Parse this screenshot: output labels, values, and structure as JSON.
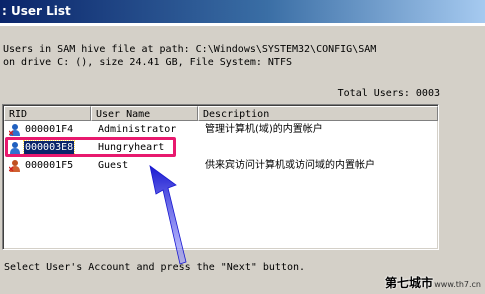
{
  "window": {
    "title": ": User List"
  },
  "info": {
    "line1": "Users in SAM hive file at path: C:\\Windows\\SYSTEM32\\CONFIG\\SAM",
    "line2": "on drive C: (), size 24.41 GB, File System: NTFS"
  },
  "total_users": "Total Users: 0003",
  "columns": {
    "rid": "RID",
    "user_name": "User Name",
    "description": "Description"
  },
  "users": [
    {
      "rid": "000001F4",
      "name": "Administrator",
      "description": "管理计算机(域)的内置帐户",
      "selected": false
    },
    {
      "rid": "000003E8",
      "name": "Hungryheart",
      "description": "",
      "selected": true
    },
    {
      "rid": "000001F5",
      "name": "Guest",
      "description": "供来宾访问计算机或访问域的内置帐户",
      "selected": false
    }
  ],
  "hint": "Select User's Account and press the \"Next\" button.",
  "watermark": {
    "text": "第七城市",
    "url": "www.th7.cn"
  },
  "colors": {
    "annotation": "#e8196e",
    "arrow": "#2a2ae0",
    "selection": "#0a246a"
  },
  "icons": {
    "admin": "user-admin-icon",
    "user": "user-icon",
    "guest": "user-guest-icon"
  }
}
